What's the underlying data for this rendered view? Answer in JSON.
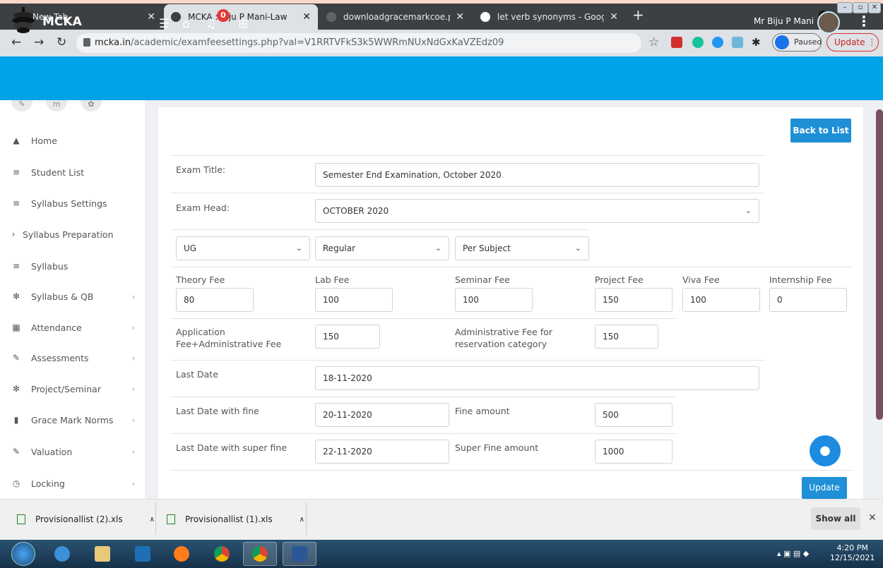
{
  "browser": {
    "tabs": [
      {
        "title": "New Tab"
      },
      {
        "title": "MCKA : Biju P Mani-Law"
      },
      {
        "title": "downloadgracemarkcoe.php"
      },
      {
        "title": "let verb synonyms - Google Searc"
      }
    ],
    "url_host": "mcka.in",
    "url_path": "/academic/examfeesettings.php?val=V1RRTVFkS3k5WWRmNUxNdGxKaVZEdz09",
    "profile_label": "Paused",
    "update_label": "Update"
  },
  "app": {
    "brand": "MCKA",
    "notification_count": "0",
    "user_name": "Mr Biju P Mani",
    "accent_color": "#00a2e8"
  },
  "sidebar": {
    "items": [
      {
        "label": "Home",
        "icon": "home-icon"
      },
      {
        "label": "Student List",
        "icon": "list-icon"
      },
      {
        "label": "Syllabus Settings",
        "icon": "list-icon"
      },
      {
        "label": "Syllabus Preparation",
        "icon": "chevron-right-icon"
      },
      {
        "label": "Syllabus",
        "icon": "list-icon"
      },
      {
        "label": "Syllabus & QB",
        "icon": "gears-icon"
      },
      {
        "label": "Attendance",
        "icon": "calendar-icon"
      },
      {
        "label": "Assessments",
        "icon": "pencil-icon"
      },
      {
        "label": "Project/Seminar",
        "icon": "gears-icon"
      },
      {
        "label": "Grace Mark Norms",
        "icon": "book-icon"
      },
      {
        "label": "Valuation",
        "icon": "pencil-icon"
      },
      {
        "label": "Locking",
        "icon": "clock-icon"
      }
    ]
  },
  "form": {
    "back_label": "Back to List",
    "exam_title_label": "Exam Title:",
    "exam_title_value": "Semester End Examination, October 2020",
    "exam_head_label": "Exam Head:",
    "exam_head_value": "OCTOBER 2020",
    "level_value": "UG",
    "type_value": "Regular",
    "fee_mode_value": "Per Subject",
    "theory_label": "Theory Fee",
    "theory_value": "80",
    "lab_label": "Lab Fee",
    "lab_value": "100",
    "seminar_label": "Seminar Fee",
    "seminar_value": "100",
    "project_label": "Project Fee",
    "project_value": "150",
    "viva_label": "Viva Fee",
    "viva_value": "100",
    "internship_label": "Internship Fee",
    "internship_value": "0",
    "application_label_1": "Application",
    "application_label_2": "Fee+Administrative Fee",
    "application_value": "150",
    "reservation_label_1": "Administrative Fee for",
    "reservation_label_2": "reservation category",
    "reservation_value": "150",
    "last_date_label": "Last Date",
    "last_date_value": "18-11-2020",
    "fine_date_label": "Last Date with fine",
    "fine_date_value": "20-11-2020",
    "fine_amount_label": "Fine amount",
    "fine_amount_value": "500",
    "super_fine_date_label": "Last Date with super fine",
    "super_fine_date_value": "22-11-2020",
    "super_fine_amount_label": "Super Fine amount",
    "super_fine_amount_value": "1000",
    "update_label": "Update"
  },
  "downloads": {
    "items": [
      {
        "name": "Provisionallist (2).xls"
      },
      {
        "name": "Provisionallist (1).xls"
      }
    ],
    "show_all_label": "Show all"
  },
  "taskbar": {
    "time": "4:20 PM",
    "date": "12/15/2021"
  }
}
